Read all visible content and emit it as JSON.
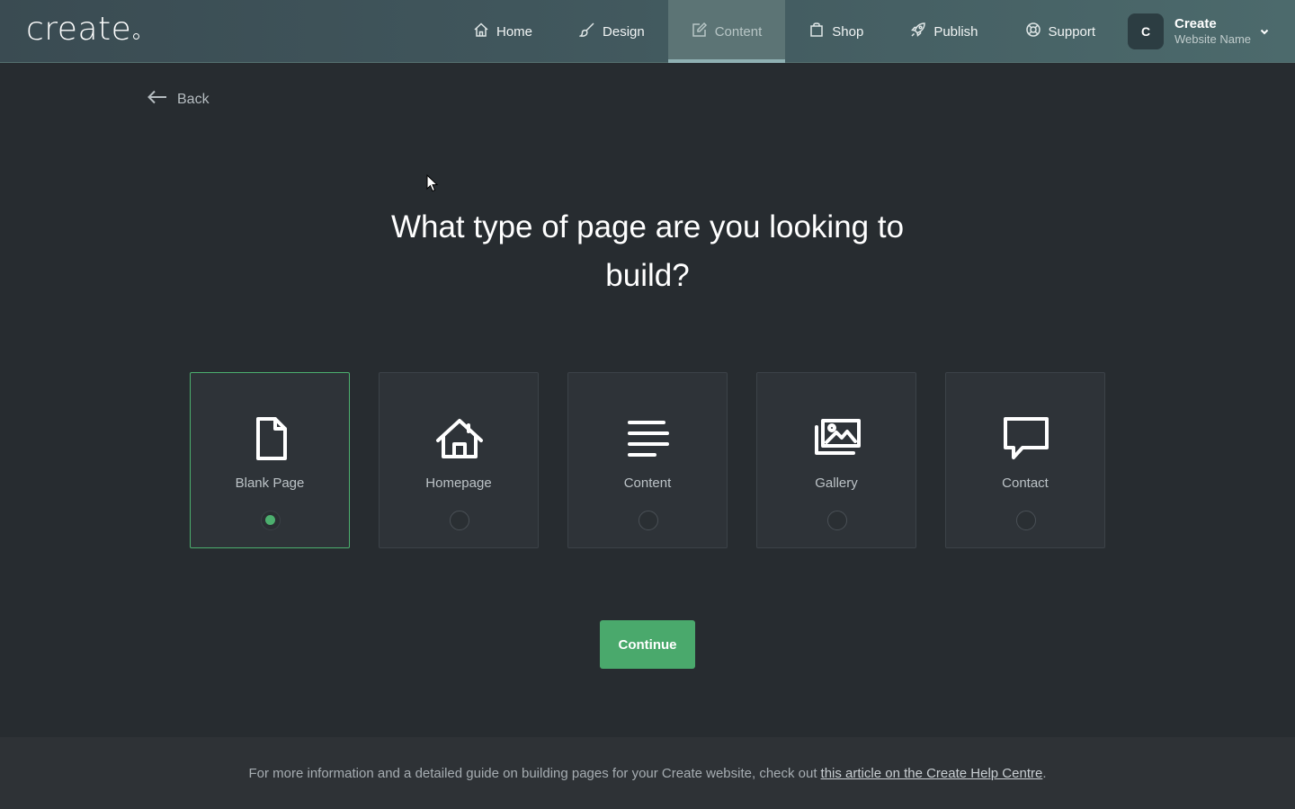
{
  "logo": {
    "text": "create"
  },
  "nav": {
    "items": [
      {
        "label": "Home",
        "icon": "home-icon"
      },
      {
        "label": "Design",
        "icon": "brush-icon"
      },
      {
        "label": "Content",
        "icon": "edit-icon",
        "active": true
      },
      {
        "label": "Shop",
        "icon": "bag-icon"
      },
      {
        "label": "Publish",
        "icon": "rocket-icon"
      },
      {
        "label": "Support",
        "icon": "lifebuoy-icon"
      }
    ]
  },
  "account": {
    "initial": "C",
    "name": "Create",
    "site": "Website Name"
  },
  "back": {
    "label": "Back"
  },
  "heading": "What type of page are you looking to build?",
  "cards": [
    {
      "label": "Blank Page",
      "icon": "blank-page-icon",
      "selected": true
    },
    {
      "label": "Homepage",
      "icon": "home-icon",
      "selected": false
    },
    {
      "label": "Content",
      "icon": "text-lines-icon",
      "selected": false
    },
    {
      "label": "Gallery",
      "icon": "gallery-icon",
      "selected": false
    },
    {
      "label": "Contact",
      "icon": "speech-bubble-icon",
      "selected": false
    }
  ],
  "continue_label": "Continue",
  "footer": {
    "text": "For more information and a detailed guide on building pages for your Create website, check out",
    "link": "this article on the Create Help Centre",
    "suffix": "."
  },
  "colors": {
    "accent": "#4aa96c",
    "background": "#272c30",
    "topbar": "#40565c"
  }
}
